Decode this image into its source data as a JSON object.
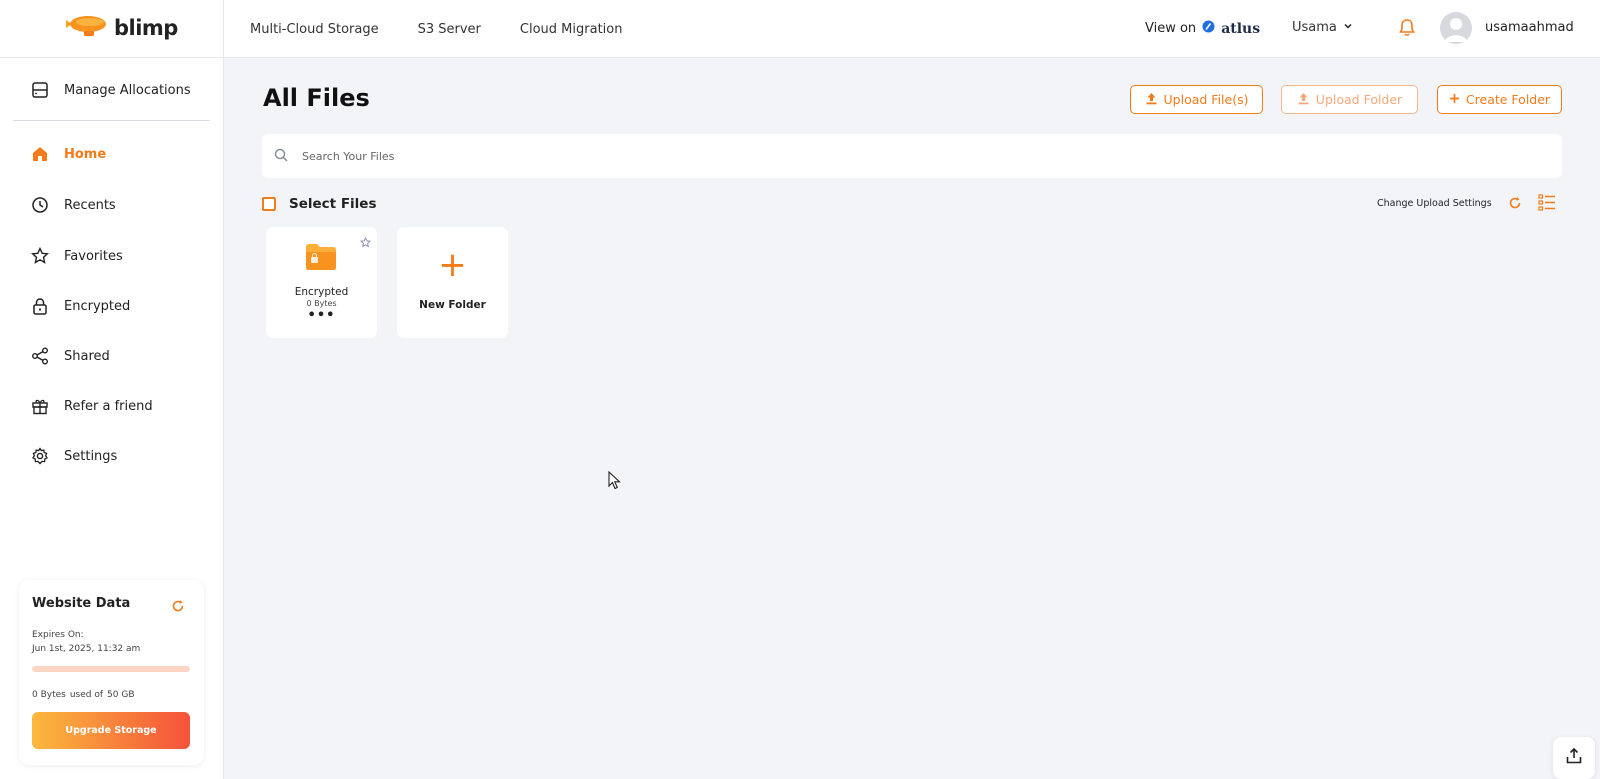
{
  "brand": {
    "name": "blimp"
  },
  "topnav": {
    "items": [
      "Multi-Cloud Storage",
      "S3 Server",
      "Cloud Migration"
    ]
  },
  "header": {
    "view_on_label": "View on",
    "atlus_label": "atlus",
    "account_label": "Usama",
    "username": "usamaahmad"
  },
  "sidebar": {
    "manage_label": "Manage Allocations",
    "items": [
      {
        "label": "Home",
        "icon": "home-icon",
        "active": true
      },
      {
        "label": "Recents",
        "icon": "clock-icon"
      },
      {
        "label": "Favorites",
        "icon": "star-icon"
      },
      {
        "label": "Encrypted",
        "icon": "lock-icon"
      },
      {
        "label": "Shared",
        "icon": "share-icon"
      },
      {
        "label": "Refer a friend",
        "icon": "gift-icon"
      },
      {
        "label": "Settings",
        "icon": "gear-icon"
      }
    ]
  },
  "storage": {
    "title": "Website Data",
    "expires_label": "Expires On:",
    "expires_value": "Jun 1st, 2025, 11:32 am",
    "used": "0 Bytes",
    "used_of": "used of",
    "total": "50 GB",
    "used_fraction": 0,
    "upgrade_label": "Upgrade Storage"
  },
  "main": {
    "title": "All Files",
    "upload_files_label": "Upload File(s)",
    "upload_folder_label": "Upload Folder",
    "create_folder_label": "Create Folder",
    "search_placeholder": "Search Your Files",
    "select_files_label": "Select Files",
    "upload_settings_label": "Change Upload Settings",
    "folders": [
      {
        "name": "Encrypted",
        "size": "0 Bytes",
        "menu": "•••"
      }
    ],
    "new_folder_label": "New Folder",
    "new_folder_symbol": "+"
  },
  "colors": {
    "accent": "#f27b1a",
    "background": "#f3f4f8"
  }
}
